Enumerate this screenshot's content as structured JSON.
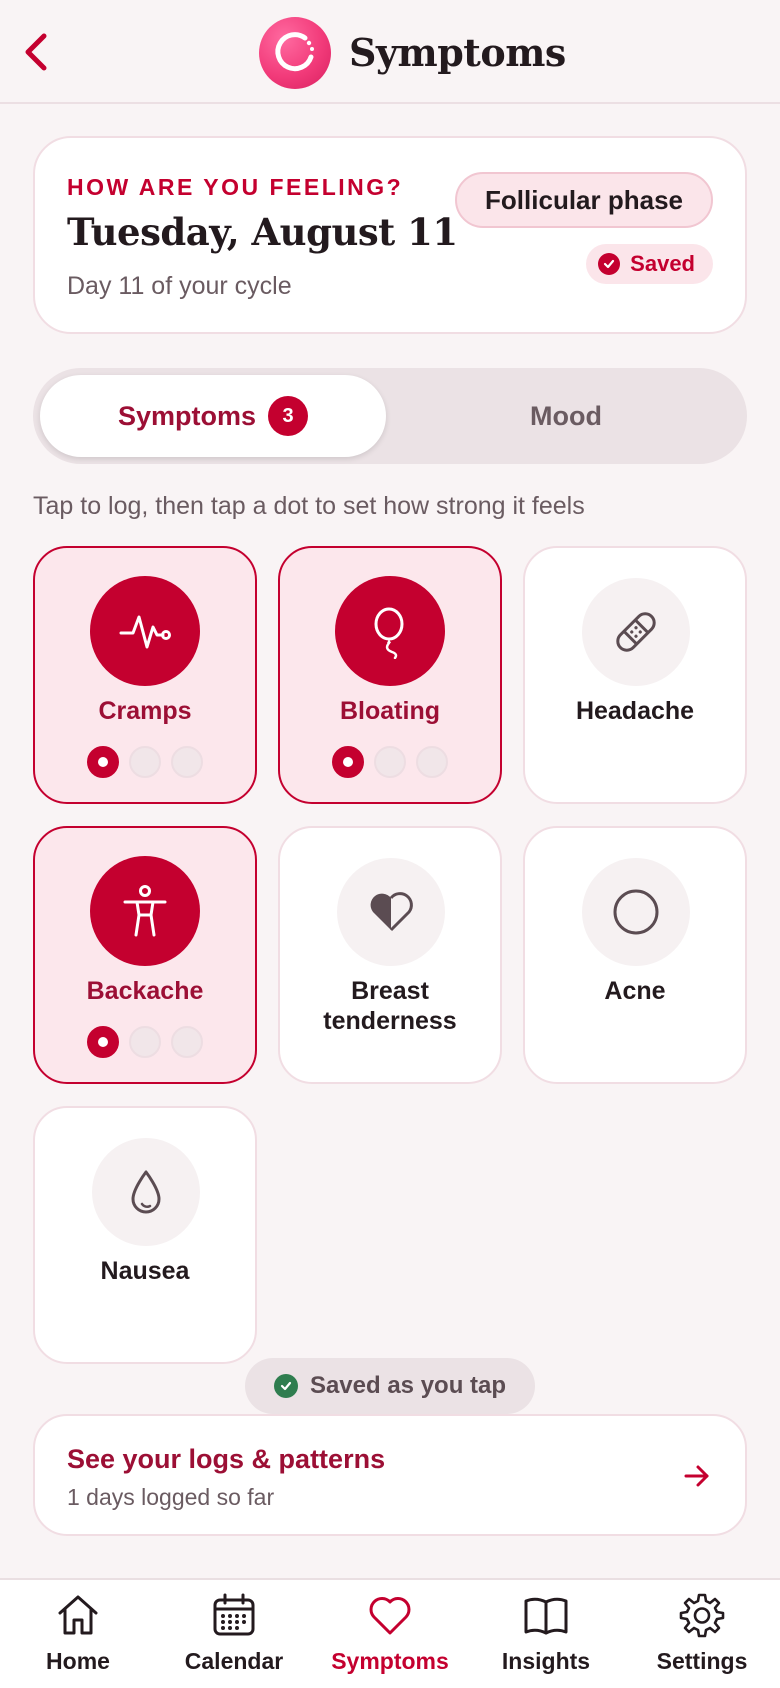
{
  "header": {
    "title": "Symptoms"
  },
  "date_card": {
    "eyebrow": "HOW ARE YOU FEELING?",
    "date": "Tuesday, August 11",
    "cycle_day": "Day 11 of your cycle",
    "phase": "Follicular phase",
    "saved": "Saved"
  },
  "tabs": {
    "symptoms_label": "Symptoms",
    "symptoms_count": "3",
    "mood_label": "Mood"
  },
  "hint": "Tap to log, then tap a dot to set how strong it feels",
  "symptoms": [
    {
      "label": "Cramps",
      "icon": "pulse-icon",
      "logged": true,
      "intensity": 1
    },
    {
      "label": "Bloating",
      "icon": "balloon-icon",
      "logged": true,
      "intensity": 1
    },
    {
      "label": "Headache",
      "icon": "bandage-icon",
      "logged": false
    },
    {
      "label": "Backache",
      "icon": "body-icon",
      "logged": true,
      "intensity": 1
    },
    {
      "label": "Breast tenderness",
      "icon": "half-heart-icon",
      "logged": false
    },
    {
      "label": "Acne",
      "icon": "circle-icon",
      "logged": false
    },
    {
      "label": "Nausea",
      "icon": "droplet-icon",
      "logged": false
    }
  ],
  "saved_note": "Saved as you tap",
  "logs_card": {
    "title": "See your logs & patterns",
    "subtitle": "1 days logged so far"
  },
  "nav": [
    {
      "label": "Home",
      "icon": "home-icon"
    },
    {
      "label": "Calendar",
      "icon": "calendar-icon"
    },
    {
      "label": "Symptoms",
      "icon": "heart-icon"
    },
    {
      "label": "Insights",
      "icon": "book-icon"
    },
    {
      "label": "Settings",
      "icon": "gear-icon"
    }
  ],
  "colors": {
    "accent": "#c4002f",
    "accent_dark": "#9c0f35",
    "tile_active_bg": "#fce7ec",
    "background": "#f9f4f5",
    "success": "#2f7d4f"
  }
}
